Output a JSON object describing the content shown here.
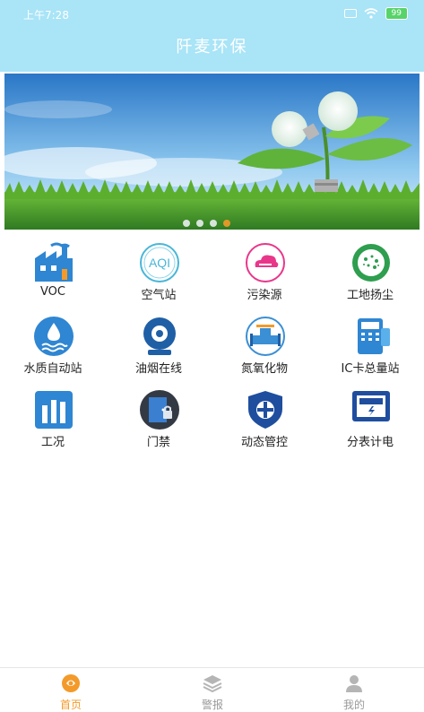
{
  "status_bar": {
    "time": "上午7:28",
    "battery": "99"
  },
  "header": {
    "title": "阡麦环保"
  },
  "banner": {
    "dots": 4,
    "active_dot": 4
  },
  "grid": {
    "items": [
      {
        "label": "VOC",
        "icon": "factory-icon"
      },
      {
        "label": "空气站",
        "icon": "aqi-icon"
      },
      {
        "label": "污染源",
        "icon": "cloud-icon"
      },
      {
        "label": "工地扬尘",
        "icon": "dust-icon"
      },
      {
        "label": "水质自动站",
        "icon": "water-drop-icon"
      },
      {
        "label": "油烟在线",
        "icon": "camera-icon"
      },
      {
        "label": "氮氧化物",
        "icon": "valve-icon"
      },
      {
        "label": "IC卡总量站",
        "icon": "card-reader-icon"
      },
      {
        "label": "工况",
        "icon": "bar-chart-icon"
      },
      {
        "label": "门禁",
        "icon": "door-lock-icon"
      },
      {
        "label": "动态管控",
        "icon": "shield-icon"
      },
      {
        "label": "分表计电",
        "icon": "electric-meter-icon"
      }
    ]
  },
  "tabbar": {
    "tabs": [
      {
        "label": "首页",
        "icon": "home-icon",
        "active": true
      },
      {
        "label": "警报",
        "icon": "layers-icon",
        "active": false
      },
      {
        "label": "我的",
        "icon": "user-icon",
        "active": false
      }
    ]
  },
  "colors": {
    "header_bg": "#a9e4f7",
    "accent": "#f39a2a",
    "icon_blue": "#2f86d2"
  }
}
